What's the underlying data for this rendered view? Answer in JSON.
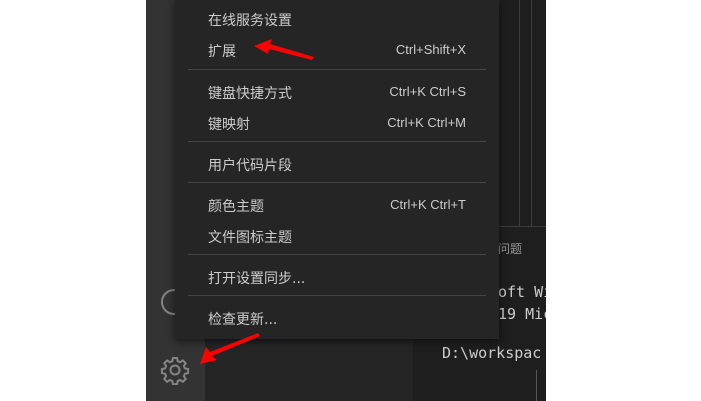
{
  "menu": {
    "items": [
      {
        "label": "在线服务设置",
        "shortcut": ""
      },
      {
        "label": "扩展",
        "shortcut": "Ctrl+Shift+X"
      },
      {
        "label": "键盘快捷方式",
        "shortcut": "Ctrl+K Ctrl+S"
      },
      {
        "label": "键映射",
        "shortcut": "Ctrl+K Ctrl+M"
      },
      {
        "label": "用户代码片段",
        "shortcut": ""
      },
      {
        "label": "颜色主题",
        "shortcut": "Ctrl+K Ctrl+T"
      },
      {
        "label": "文件图标主题",
        "shortcut": ""
      },
      {
        "label": "打开设置同步...",
        "shortcut": ""
      },
      {
        "label": "检查更新...",
        "shortcut": ""
      }
    ]
  },
  "panel": {
    "tab_label": "问题",
    "terminal_lines": [
      "oft Wi",
      "19 Mic",
      "D:\\workspac"
    ]
  },
  "activity_bar": {
    "icons": [
      "accounts-icon",
      "gear-icon"
    ]
  },
  "colors": {
    "menu_bg": "#252526",
    "menu_text": "#cccccc",
    "separator": "#454545",
    "annotation_arrow": "#ff0000"
  }
}
